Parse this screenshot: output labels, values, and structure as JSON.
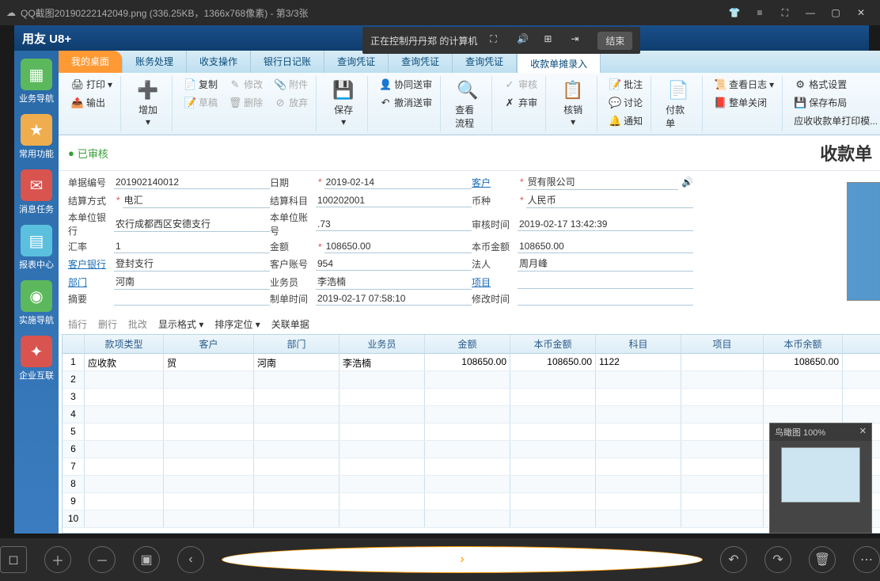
{
  "titlebar": {
    "filename": "QQ截图20190222142049.png (336.25KB，1366x768像素) - 第3/3张"
  },
  "brand": "用友 U8+",
  "remote": {
    "text": "正在控制丹丹郑 的计算机",
    "end": "结束"
  },
  "sidebar": [
    {
      "label": "业务导航"
    },
    {
      "label": "常用功能"
    },
    {
      "label": "消息任务"
    },
    {
      "label": "报表中心"
    },
    {
      "label": "实施导航"
    },
    {
      "label": "企业互联"
    }
  ],
  "tabs": {
    "home": "我的桌面",
    "t1": "账务处理",
    "t2": "收支操作",
    "t3": "银行日记账",
    "t4": "查询凭证",
    "t5": "查询凭证",
    "t6": "查询凭证",
    "active": "收款单摊录入"
  },
  "ribbon": {
    "print": "打印",
    "output": "输出",
    "add": "增加",
    "copy": "复制",
    "modify": "修改",
    "attach": "附件",
    "draft": "草稿",
    "delete": "删除",
    "discard": "放弃",
    "save": "保存",
    "cosign": "协同送审",
    "undo": "撤消送审",
    "flow": "查看流程",
    "audit": "审核",
    "abandon": "弃审",
    "verify": "核销",
    "comment": "批注",
    "discuss": "讨论",
    "notify": "通知",
    "pay": "付款单",
    "log": "查看日志",
    "fullclose": "整单关闭",
    "format": "格式设置",
    "savelayout": "保存布局",
    "printtpl": "应收收款单打印模..."
  },
  "status": {
    "audited": "已审核"
  },
  "doctitle": "收款单",
  "form": {
    "docno_l": "单据编号",
    "docno": "201902140012",
    "date_l": "日期",
    "date": "2019-02-14",
    "cust_l": "客户",
    "cust": "贸有限公司",
    "settle_l": "结算方式",
    "settle": "电汇",
    "subj_l": "结算科目",
    "subj": "100202001",
    "curr_l": "币种",
    "curr": "人民币",
    "bank_l": "本单位银行",
    "bank": "农行成都西区安德支行",
    "acct_l": "本单位账号",
    "acct": ".73",
    "audittime_l": "审核时间",
    "audittime": "2019-02-17 13:42:39",
    "rate_l": "汇率",
    "rate": "1",
    "amt_l": "金额",
    "amt": "108650.00",
    "bamt_l": "本币金额",
    "bamt": "108650.00",
    "cbank_l": "客户银行",
    "cbank": "登封支行",
    "cacct_l": "客户账号",
    "cacct": "954",
    "legal_l": "法人",
    "legal": "周月峰",
    "dept_l": "部门",
    "dept": "河南",
    "sales_l": "业务员",
    "sales": "李浩楠",
    "proj_l": "项目",
    "proj": "",
    "memo_l": "摘要",
    "memo": "",
    "maketime_l": "制单时间",
    "maketime": "2019-02-17 07:58:10",
    "modtime_l": "修改时间",
    "modtime": ""
  },
  "tbar": {
    "insert": "插行",
    "delrow": "删行",
    "batch": "批改",
    "dispfmt": "显示格式",
    "sortpos": "排序定位",
    "reldoc": "关联单据"
  },
  "grid": {
    "headers": [
      "",
      "款项类型",
      "客户",
      "部门",
      "业务员",
      "金额",
      "本币金额",
      "科目",
      "项目",
      "本币余额"
    ],
    "rows": [
      {
        "n": "1",
        "type": "应收款",
        "cust": "贸",
        "dept": "河南",
        "sales": "李浩楠",
        "amt": "108650.00",
        "bamt": "108650.00",
        "subj": "1122",
        "proj": "",
        "bal": "108650.00"
      },
      {
        "n": "2"
      },
      {
        "n": "3"
      },
      {
        "n": "4"
      },
      {
        "n": "5"
      },
      {
        "n": "6"
      },
      {
        "n": "7"
      },
      {
        "n": "8"
      },
      {
        "n": "9"
      },
      {
        "n": "10"
      }
    ]
  },
  "thumb": {
    "title": "鸟瞰图 100%"
  }
}
